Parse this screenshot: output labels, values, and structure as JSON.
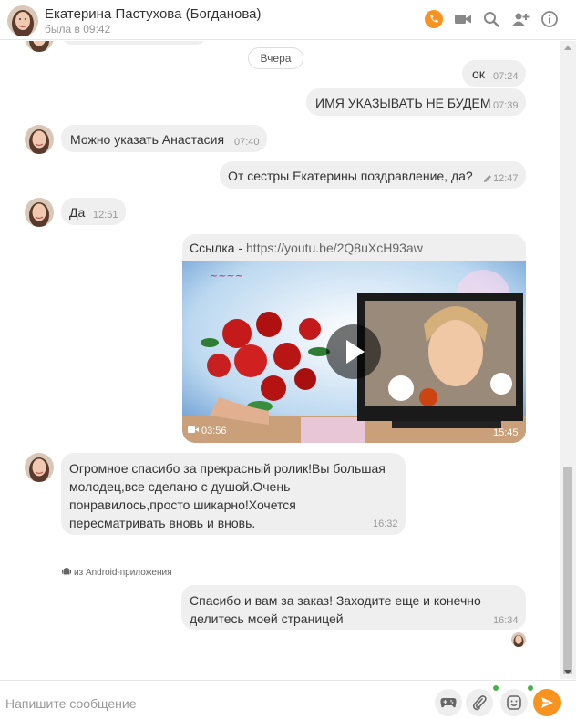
{
  "header": {
    "name": "Екатерина Пастухова (Богданова)",
    "status": "была в 09:42",
    "icons": [
      "phone-call-icon",
      "video-call-icon",
      "search-icon",
      "add-user-icon",
      "info-icon"
    ],
    "accent": "#f7931e"
  },
  "chat": {
    "date_divider": "Вчера",
    "messages": [
      {
        "side": "out",
        "text": "ок",
        "time": "07:24"
      },
      {
        "side": "out",
        "text": "ИМЯ УКАЗЫВАТЬ НЕ БУДЕМ",
        "time": "07:39"
      },
      {
        "side": "in",
        "text": "Можно указать Анастасия",
        "time": "07:40"
      },
      {
        "side": "out",
        "text": "От сестры Екатерины поздравление, да?",
        "time": "12:47",
        "edited": true
      },
      {
        "side": "in",
        "text": "Да",
        "time": "12:51"
      },
      {
        "side": "out",
        "type": "video",
        "link_label": "Ссылка - ",
        "link_url": "https://youtu.be/2Q8uXcH93aw",
        "duration": "03:56",
        "time": "15:45"
      },
      {
        "side": "in",
        "lines": [
          "Огромное спасибо за прекрасный ролик!Вы большая",
          "молодец,все сделано с душой.Очень",
          "понравилось,просто шикарно!Хочется",
          "пересматривать вновь и вновь."
        ],
        "time": "16:32"
      },
      {
        "side": "out",
        "lines": [
          "Спасибо и вам за заказ! Заходите еще и конечно",
          "делитесь моей страницей"
        ],
        "time": "16:34"
      }
    ],
    "android_note": "из Android-приложения"
  },
  "composer": {
    "placeholder": "Напишите сообщение",
    "icons": [
      "gamepad-icon",
      "paperclip-icon",
      "emoji-icon",
      "send-icon"
    ]
  }
}
